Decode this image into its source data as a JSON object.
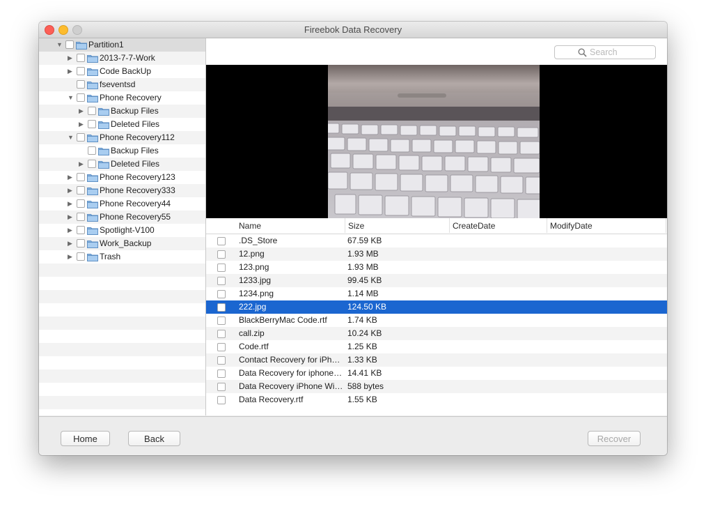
{
  "window": {
    "title": "Fireebok Data Recovery"
  },
  "search": {
    "placeholder": "Search"
  },
  "tree": [
    {
      "label": "Partition1",
      "level": 0,
      "arrow": "down",
      "selected": true
    },
    {
      "label": "2013-7-7-Work",
      "level": 1,
      "arrow": "right"
    },
    {
      "label": "Code BackUp",
      "level": 1,
      "arrow": "right"
    },
    {
      "label": "fseventsd",
      "level": 1,
      "arrow": "none"
    },
    {
      "label": "Phone Recovery",
      "level": 1,
      "arrow": "down"
    },
    {
      "label": "Backup Files",
      "level": 2,
      "arrow": "right"
    },
    {
      "label": "Deleted Files",
      "level": 2,
      "arrow": "right"
    },
    {
      "label": "Phone Recovery112",
      "level": 1,
      "arrow": "down"
    },
    {
      "label": "Backup Files",
      "level": 2,
      "arrow": "none"
    },
    {
      "label": "Deleted Files",
      "level": 2,
      "arrow": "right"
    },
    {
      "label": "Phone Recovery123",
      "level": 1,
      "arrow": "right"
    },
    {
      "label": "Phone Recovery333",
      "level": 1,
      "arrow": "right"
    },
    {
      "label": "Phone Recovery44",
      "level": 1,
      "arrow": "right"
    },
    {
      "label": "Phone Recovery55",
      "level": 1,
      "arrow": "right"
    },
    {
      "label": "Spotlight-V100",
      "level": 1,
      "arrow": "right"
    },
    {
      "label": "Work_Backup",
      "level": 1,
      "arrow": "right"
    },
    {
      "label": "Trash",
      "level": 1,
      "arrow": "right"
    }
  ],
  "table": {
    "columns": [
      "Name",
      "Size",
      "CreateDate",
      "ModifyDate"
    ],
    "rows": [
      {
        "name": ".DS_Store",
        "size": "67.59 KB"
      },
      {
        "name": "12.png",
        "size": "1.93 MB"
      },
      {
        "name": "123.png",
        "size": "1.93 MB"
      },
      {
        "name": "1233.jpg",
        "size": "99.45 KB"
      },
      {
        "name": "1234.png",
        "size": "1.14 MB"
      },
      {
        "name": "222.jpg",
        "size": "124.50 KB",
        "selected": true
      },
      {
        "name": "BlackBerryMac Code.rtf",
        "size": "1.74 KB"
      },
      {
        "name": "call.zip",
        "size": "10.24 KB"
      },
      {
        "name": "Code.rtf",
        "size": "1.25 KB"
      },
      {
        "name": "Contact Recovery for iPho…",
        "size": "1.33 KB"
      },
      {
        "name": "Data Recovery for iphone…",
        "size": "14.41 KB"
      },
      {
        "name": "Data Recovery iPhone Win…",
        "size": "588 bytes"
      },
      {
        "name": "Data Recovery.rtf",
        "size": "1.55 KB"
      }
    ]
  },
  "buttons": {
    "home": "Home",
    "back": "Back",
    "recover": "Recover"
  },
  "icons": {
    "folder": "folder-icon",
    "search": "search-icon",
    "expand": "triangle-right-icon",
    "collapse": "triangle-down-icon"
  },
  "colors": {
    "selection": "#1b66d0",
    "folder": "#8fb9e3"
  }
}
